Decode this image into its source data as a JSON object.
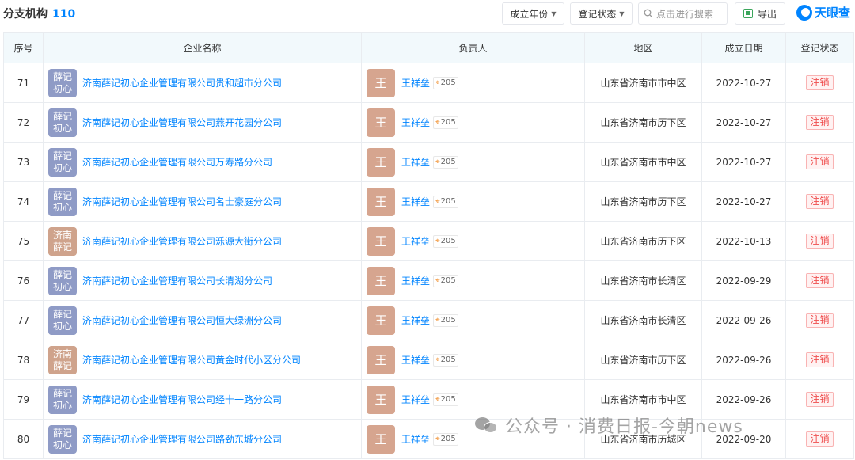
{
  "header": {
    "title": "分支机构",
    "count": "110",
    "year_filter": "成立年份",
    "status_filter": "登记状态",
    "search_placeholder": "点击进行搜索",
    "export_label": "导出",
    "brand": "天眼查"
  },
  "table": {
    "columns": [
      "序号",
      "企业名称",
      "负责人",
      "地区",
      "成立日期",
      "登记状态"
    ],
    "rows": [
      {
        "no": "71",
        "logo": "薛记初心",
        "logo_color": "#8f9bc6",
        "name": "济南薛记初心企业管理有限公司贵和超市分公司",
        "person_avatar": "王",
        "person": "王祥垒",
        "person_count": "205",
        "region": "山东省济南市市中区",
        "date": "2022-10-27",
        "status": "注销"
      },
      {
        "no": "72",
        "logo": "薛记初心",
        "logo_color": "#8f9bc6",
        "name": "济南薛记初心企业管理有限公司燕开花园分公司",
        "person_avatar": "王",
        "person": "王祥垒",
        "person_count": "205",
        "region": "山东省济南市历下区",
        "date": "2022-10-27",
        "status": "注销"
      },
      {
        "no": "73",
        "logo": "薛记初心",
        "logo_color": "#8f9bc6",
        "name": "济南薛记初心企业管理有限公司万寿路分公司",
        "person_avatar": "王",
        "person": "王祥垒",
        "person_count": "205",
        "region": "山东省济南市市中区",
        "date": "2022-10-27",
        "status": "注销"
      },
      {
        "no": "74",
        "logo": "薛记初心",
        "logo_color": "#8f9bc6",
        "name": "济南薛记初心企业管理有限公司名士豪庭分公司",
        "person_avatar": "王",
        "person": "王祥垒",
        "person_count": "205",
        "region": "山东省济南市历下区",
        "date": "2022-10-27",
        "status": "注销"
      },
      {
        "no": "75",
        "logo": "济南薛记",
        "logo_color": "#cfa38c",
        "name": "济南薛记初心企业管理有限公司泺源大街分公司",
        "person_avatar": "王",
        "person": "王祥垒",
        "person_count": "205",
        "region": "山东省济南市历下区",
        "date": "2022-10-13",
        "status": "注销"
      },
      {
        "no": "76",
        "logo": "薛记初心",
        "logo_color": "#8f9bc6",
        "name": "济南薛记初心企业管理有限公司长清湖分公司",
        "person_avatar": "王",
        "person": "王祥垒",
        "person_count": "205",
        "region": "山东省济南市长清区",
        "date": "2022-09-29",
        "status": "注销"
      },
      {
        "no": "77",
        "logo": "薛记初心",
        "logo_color": "#8f9bc6",
        "name": "济南薛记初心企业管理有限公司恒大绿洲分公司",
        "person_avatar": "王",
        "person": "王祥垒",
        "person_count": "205",
        "region": "山东省济南市长清区",
        "date": "2022-09-26",
        "status": "注销"
      },
      {
        "no": "78",
        "logo": "济南薛记",
        "logo_color": "#cfa38c",
        "name": "济南薛记初心企业管理有限公司黄金时代小区分公司",
        "person_avatar": "王",
        "person": "王祥垒",
        "person_count": "205",
        "region": "山东省济南市历下区",
        "date": "2022-09-26",
        "status": "注销"
      },
      {
        "no": "79",
        "logo": "薛记初心",
        "logo_color": "#8f9bc6",
        "name": "济南薛记初心企业管理有限公司经十一路分公司",
        "person_avatar": "王",
        "person": "王祥垒",
        "person_count": "205",
        "region": "山东省济南市市中区",
        "date": "2022-09-26",
        "status": "注销"
      },
      {
        "no": "80",
        "logo": "薛记初心",
        "logo_color": "#8f9bc6",
        "name": "济南薛记初心企业管理有限公司路劲东城分公司",
        "person_avatar": "王",
        "person": "王祥垒",
        "person_count": "205",
        "region": "山东省济南市历城区",
        "date": "2022-09-20",
        "status": "注销"
      }
    ]
  },
  "watermark": {
    "text": "公众号 · 消费日报-今朝news",
    "icon": "wechat-icon"
  }
}
